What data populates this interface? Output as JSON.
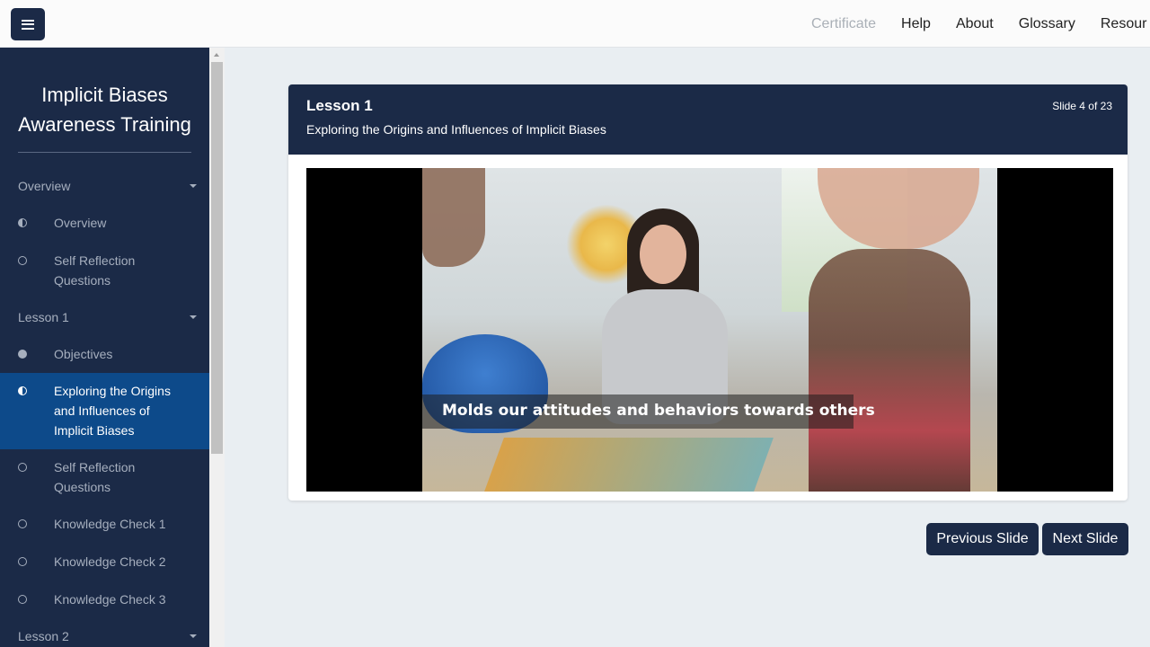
{
  "topbar": {
    "menu_icon": "hamburger-icon",
    "nav": [
      {
        "label": "Certificate",
        "disabled": true
      },
      {
        "label": "Help",
        "disabled": false
      },
      {
        "label": "About",
        "disabled": false
      },
      {
        "label": "Glossary",
        "disabled": false
      },
      {
        "label": "Resour",
        "disabled": false
      }
    ]
  },
  "sidebar": {
    "title_line1": "Implicit Biases",
    "title_line2": "Awareness Training",
    "sections": [
      {
        "label": "Overview"
      },
      {
        "label": "Lesson 1"
      },
      {
        "label": "Lesson 2"
      }
    ],
    "items": [
      {
        "label": "Overview",
        "status": "half"
      },
      {
        "label": "Self Reflection Questions",
        "status": "empty"
      },
      {
        "label": "Objectives",
        "status": "full"
      },
      {
        "label": "Exploring the Origins and Influences of Implicit Biases",
        "status": "half",
        "active": true
      },
      {
        "label": "Self Reflection Questions",
        "status": "empty"
      },
      {
        "label": "Knowledge Check 1",
        "status": "empty"
      },
      {
        "label": "Knowledge Check 2",
        "status": "empty"
      },
      {
        "label": "Knowledge Check 3",
        "status": "empty"
      }
    ]
  },
  "lesson": {
    "title": "Lesson 1",
    "subtitle": "Exploring the Origins and Influences of Implicit Biases",
    "slide_counter": "Slide 4 of 23",
    "video_caption": "Molds our attitudes and behaviors towards others"
  },
  "buttons": {
    "previous": "Previous Slide",
    "next": "Next Slide"
  },
  "colors": {
    "navy": "#1b2a47",
    "active_item": "#0d4a8a",
    "page_bg": "#e9eef2"
  }
}
